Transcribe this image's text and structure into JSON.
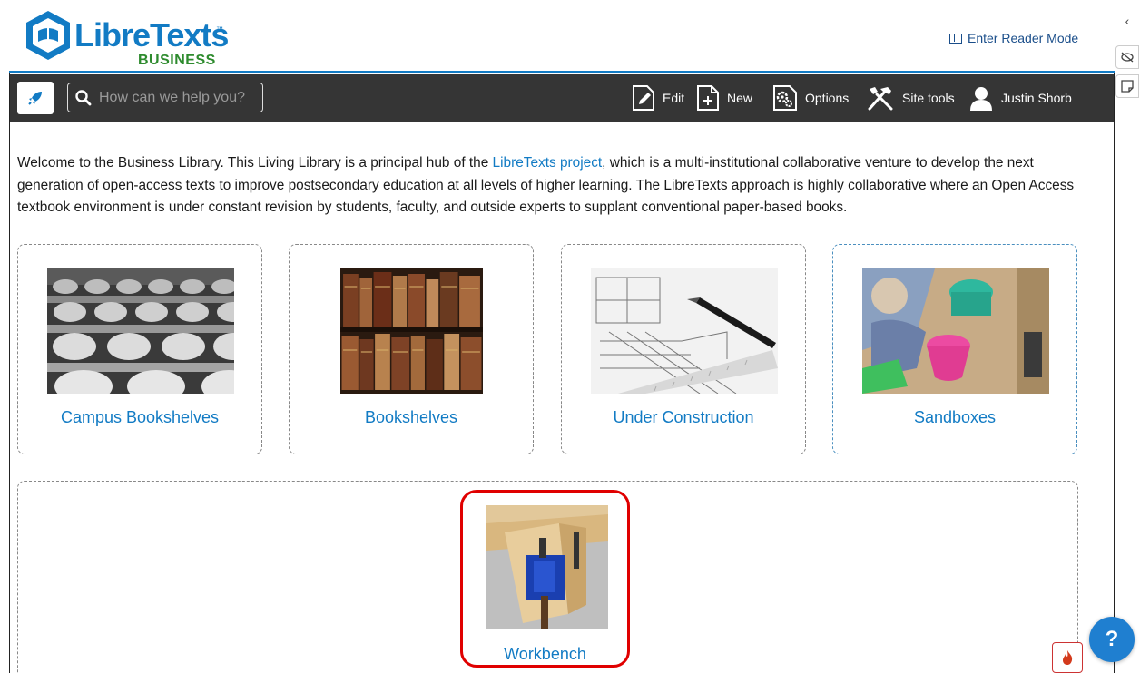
{
  "header": {
    "logo_text": "LibreTexts",
    "logo_tm": "™",
    "logo_sub": "BUSINESS",
    "reader_mode_label": "Enter Reader Mode"
  },
  "toolbar": {
    "search_placeholder": "How can we help you?",
    "edit_label": "Edit",
    "new_label": "New",
    "options_label": "Options",
    "site_tools_label": "Site tools",
    "user_name": "Justin Shorb"
  },
  "intro": {
    "text_before": "Welcome to the Business Library. This Living Library is a principal hub of the ",
    "link_text": "LibreTexts project",
    "text_after": ", which is a multi-institutional collaborative venture to develop the next generation of open-access texts to improve postsecondary education at all levels of higher learning. The LibreTexts approach is highly collaborative where an Open Access textbook environment is under constant revision by students, faculty, and outside experts to supplant conventional paper-based books."
  },
  "cards": [
    {
      "label": "Campus Bookshelves",
      "image": "lecture-hall-seats"
    },
    {
      "label": "Bookshelves",
      "image": "old-books-shelf"
    },
    {
      "label": "Under Construction",
      "image": "blueprint-pen"
    },
    {
      "label": "Sandboxes",
      "image": "kids-sandbox-toys"
    }
  ],
  "workbench": {
    "label": "Workbench",
    "image": "wood-vise-workbench"
  },
  "help_label": "?",
  "colors": {
    "accent": "#127bc4",
    "toolbar_bg": "#353535",
    "logo_green": "#2e8b2e",
    "highlight": "#e00000"
  }
}
